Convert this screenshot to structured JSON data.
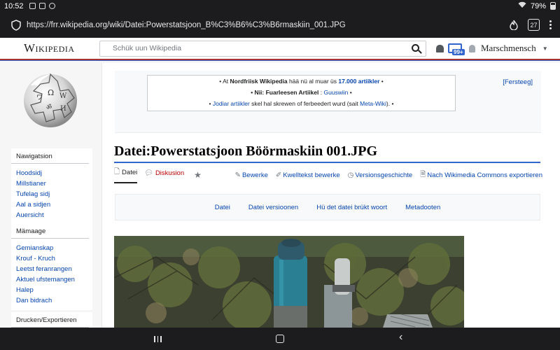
{
  "status_bar": {
    "time": "10:52",
    "battery": "79%"
  },
  "browser": {
    "url": "https://frr.wikipedia.org/wiki/Datei:Powerstatsjoon_B%C3%B6%C3%B6rmaskiin_001.JPG",
    "tab_count": "27"
  },
  "header": {
    "wordmark": "Wikipedia",
    "search_placeholder": "Schük uun Wikipedia",
    "notices_badge": "99+",
    "username": "Marschmensch"
  },
  "sitenotice": {
    "line1_pre": "• At ",
    "line1_bold": "Nordfriisk Wikipedia",
    "line1_mid": " hää nü al muar üs ",
    "line1_link": "17.000 artiikler",
    "line1_post": " •",
    "line2_bold": "• Nii: Fuarleesen Artiikel",
    "line2_sep": " : ",
    "line2_link": "Guuswiin",
    "line2_post": " •",
    "line3_pre": "• ",
    "line3_link1": "Jodiar",
    "line3_sp": " ",
    "line3_link2": "artiikler",
    "line3_mid": " skel hal skrewen of ferbeedert wurd (sait ",
    "line3_link3": "Meta-Wiki",
    "line3_post": "). •",
    "hide_link": "[Fersteeg]"
  },
  "sidebar": {
    "nav": {
      "heading": "Nawigatsion",
      "items": [
        "Hoodsidj",
        "Millstianer",
        "Tufelag sidj",
        "Aal a sidjen",
        "Auersicht"
      ]
    },
    "community": {
      "heading": "Mämaage",
      "items": [
        "Gemianskap",
        "Krouf - Kruch",
        "Leetst feranrangen",
        "Aktuel ufstemangen",
        "Halep",
        "Dan bidrach"
      ]
    },
    "print": {
      "heading": "Drucken/Exportieren"
    }
  },
  "page": {
    "title": "Datei:Powerstatsjoon Böörmaskiin 001.JPG",
    "tabs": {
      "file": "Datei",
      "talk": "Diskusion"
    },
    "actions": {
      "edit": "Bewerke",
      "edit_source": "Kwelltekst bewerke",
      "history": "Versionsgeschichte",
      "commons": "Nach Wikimedia Commons exportieren"
    },
    "filetoc": [
      "Datei",
      "Datei versioonen",
      "Hü det datei brükt woort",
      "Metadooten"
    ]
  },
  "colors": {
    "link": "#0645ad",
    "talk_red": "#ba0000",
    "accent_blue": "#3366cc",
    "header_rule": "#aa3333"
  }
}
